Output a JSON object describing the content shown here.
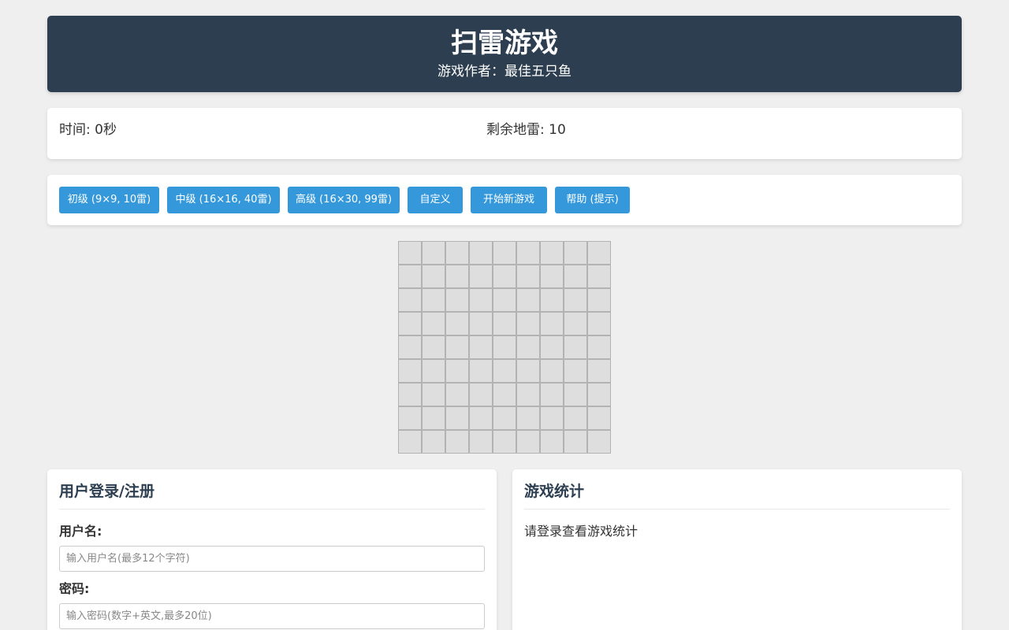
{
  "header": {
    "title": "扫雷游戏",
    "author": "游戏作者：最佳五只鱼"
  },
  "status": {
    "timer": "时间: 0秒",
    "mines": "剩余地雷: 10"
  },
  "controls": {
    "beginner": "初级 (9×9, 10雷)",
    "intermediate": "中级 (16×16, 40雷)",
    "expert": "高级 (16×30, 99雷)",
    "custom": "自定义",
    "new_game": "开始新游戏",
    "help": "帮助 (提示)"
  },
  "board": {
    "rows": 9,
    "cols": 9
  },
  "login": {
    "title": "用户登录/注册",
    "username_label": "用户名:",
    "username_placeholder": "输入用户名(最多12个字符)",
    "password_label": "密码:",
    "password_placeholder": "输入密码(数字+英文,最多20位)"
  },
  "stats": {
    "title": "游戏统计",
    "message": "请登录查看游戏统计"
  },
  "colors": {
    "header_bg": "#2c3e50",
    "button_bg": "#3498db",
    "cell_bg": "#dedede"
  }
}
